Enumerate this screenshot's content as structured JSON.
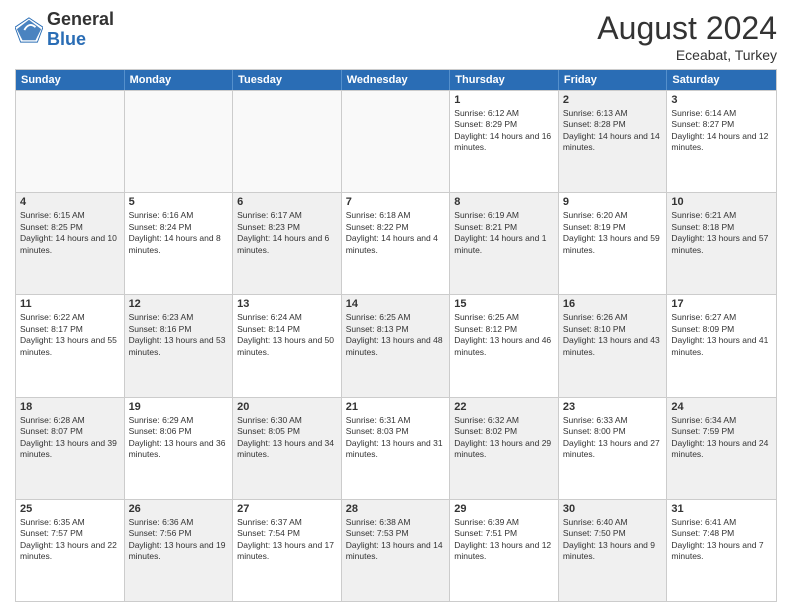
{
  "logo": {
    "general": "General",
    "blue": "Blue"
  },
  "header": {
    "month_year": "August 2024",
    "location": "Eceabat, Turkey"
  },
  "days_of_week": [
    "Sunday",
    "Monday",
    "Tuesday",
    "Wednesday",
    "Thursday",
    "Friday",
    "Saturday"
  ],
  "weeks": [
    [
      {
        "day": "",
        "text": "",
        "empty": true
      },
      {
        "day": "",
        "text": "",
        "empty": true
      },
      {
        "day": "",
        "text": "",
        "empty": true
      },
      {
        "day": "",
        "text": "",
        "empty": true
      },
      {
        "day": "1",
        "text": "Sunrise: 6:12 AM\nSunset: 8:29 PM\nDaylight: 14 hours and 16 minutes.",
        "shaded": false
      },
      {
        "day": "2",
        "text": "Sunrise: 6:13 AM\nSunset: 8:28 PM\nDaylight: 14 hours and 14 minutes.",
        "shaded": true
      },
      {
        "day": "3",
        "text": "Sunrise: 6:14 AM\nSunset: 8:27 PM\nDaylight: 14 hours and 12 minutes.",
        "shaded": false
      }
    ],
    [
      {
        "day": "4",
        "text": "Sunrise: 6:15 AM\nSunset: 8:25 PM\nDaylight: 14 hours and 10 minutes.",
        "shaded": true
      },
      {
        "day": "5",
        "text": "Sunrise: 6:16 AM\nSunset: 8:24 PM\nDaylight: 14 hours and 8 minutes.",
        "shaded": false
      },
      {
        "day": "6",
        "text": "Sunrise: 6:17 AM\nSunset: 8:23 PM\nDaylight: 14 hours and 6 minutes.",
        "shaded": true
      },
      {
        "day": "7",
        "text": "Sunrise: 6:18 AM\nSunset: 8:22 PM\nDaylight: 14 hours and 4 minutes.",
        "shaded": false
      },
      {
        "day": "8",
        "text": "Sunrise: 6:19 AM\nSunset: 8:21 PM\nDaylight: 14 hours and 1 minute.",
        "shaded": true
      },
      {
        "day": "9",
        "text": "Sunrise: 6:20 AM\nSunset: 8:19 PM\nDaylight: 13 hours and 59 minutes.",
        "shaded": false
      },
      {
        "day": "10",
        "text": "Sunrise: 6:21 AM\nSunset: 8:18 PM\nDaylight: 13 hours and 57 minutes.",
        "shaded": true
      }
    ],
    [
      {
        "day": "11",
        "text": "Sunrise: 6:22 AM\nSunset: 8:17 PM\nDaylight: 13 hours and 55 minutes.",
        "shaded": false
      },
      {
        "day": "12",
        "text": "Sunrise: 6:23 AM\nSunset: 8:16 PM\nDaylight: 13 hours and 53 minutes.",
        "shaded": true
      },
      {
        "day": "13",
        "text": "Sunrise: 6:24 AM\nSunset: 8:14 PM\nDaylight: 13 hours and 50 minutes.",
        "shaded": false
      },
      {
        "day": "14",
        "text": "Sunrise: 6:25 AM\nSunset: 8:13 PM\nDaylight: 13 hours and 48 minutes.",
        "shaded": true
      },
      {
        "day": "15",
        "text": "Sunrise: 6:25 AM\nSunset: 8:12 PM\nDaylight: 13 hours and 46 minutes.",
        "shaded": false
      },
      {
        "day": "16",
        "text": "Sunrise: 6:26 AM\nSunset: 8:10 PM\nDaylight: 13 hours and 43 minutes.",
        "shaded": true
      },
      {
        "day": "17",
        "text": "Sunrise: 6:27 AM\nSunset: 8:09 PM\nDaylight: 13 hours and 41 minutes.",
        "shaded": false
      }
    ],
    [
      {
        "day": "18",
        "text": "Sunrise: 6:28 AM\nSunset: 8:07 PM\nDaylight: 13 hours and 39 minutes.",
        "shaded": true
      },
      {
        "day": "19",
        "text": "Sunrise: 6:29 AM\nSunset: 8:06 PM\nDaylight: 13 hours and 36 minutes.",
        "shaded": false
      },
      {
        "day": "20",
        "text": "Sunrise: 6:30 AM\nSunset: 8:05 PM\nDaylight: 13 hours and 34 minutes.",
        "shaded": true
      },
      {
        "day": "21",
        "text": "Sunrise: 6:31 AM\nSunset: 8:03 PM\nDaylight: 13 hours and 31 minutes.",
        "shaded": false
      },
      {
        "day": "22",
        "text": "Sunrise: 6:32 AM\nSunset: 8:02 PM\nDaylight: 13 hours and 29 minutes.",
        "shaded": true
      },
      {
        "day": "23",
        "text": "Sunrise: 6:33 AM\nSunset: 8:00 PM\nDaylight: 13 hours and 27 minutes.",
        "shaded": false
      },
      {
        "day": "24",
        "text": "Sunrise: 6:34 AM\nSunset: 7:59 PM\nDaylight: 13 hours and 24 minutes.",
        "shaded": true
      }
    ],
    [
      {
        "day": "25",
        "text": "Sunrise: 6:35 AM\nSunset: 7:57 PM\nDaylight: 13 hours and 22 minutes.",
        "shaded": false
      },
      {
        "day": "26",
        "text": "Sunrise: 6:36 AM\nSunset: 7:56 PM\nDaylight: 13 hours and 19 minutes.",
        "shaded": true
      },
      {
        "day": "27",
        "text": "Sunrise: 6:37 AM\nSunset: 7:54 PM\nDaylight: 13 hours and 17 minutes.",
        "shaded": false
      },
      {
        "day": "28",
        "text": "Sunrise: 6:38 AM\nSunset: 7:53 PM\nDaylight: 13 hours and 14 minutes.",
        "shaded": true
      },
      {
        "day": "29",
        "text": "Sunrise: 6:39 AM\nSunset: 7:51 PM\nDaylight: 13 hours and 12 minutes.",
        "shaded": false
      },
      {
        "day": "30",
        "text": "Sunrise: 6:40 AM\nSunset: 7:50 PM\nDaylight: 13 hours and 9 minutes.",
        "shaded": true
      },
      {
        "day": "31",
        "text": "Sunrise: 6:41 AM\nSunset: 7:48 PM\nDaylight: 13 hours and 7 minutes.",
        "shaded": false
      }
    ]
  ]
}
